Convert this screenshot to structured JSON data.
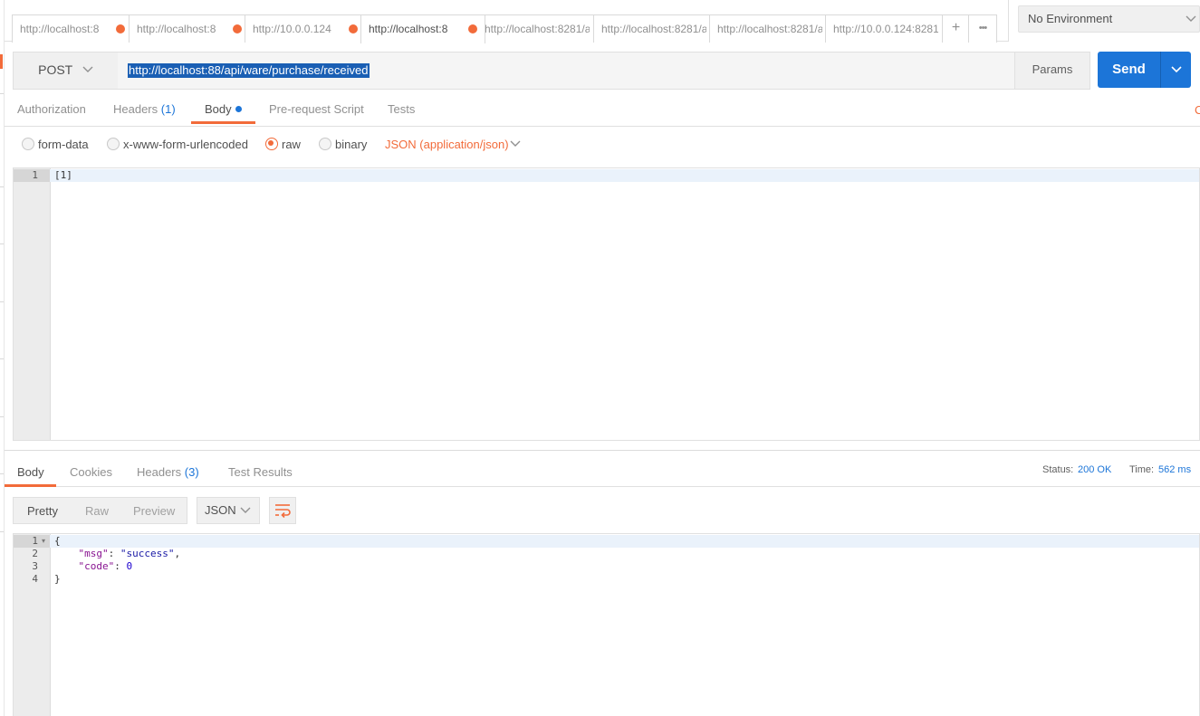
{
  "tabs": [
    {
      "label": "http://localhost:8",
      "unsaved": true
    },
    {
      "label": "http://localhost:8",
      "unsaved": true
    },
    {
      "label": "http://10.0.0.124",
      "unsaved": true
    },
    {
      "label": "http://localhost:8",
      "unsaved": true,
      "active": true
    },
    {
      "label": "http://localhost:8281/a",
      "unsaved": false
    },
    {
      "label": "http://localhost:8281/a",
      "unsaved": false
    },
    {
      "label": "http://localhost:8281/a",
      "unsaved": false
    },
    {
      "label": "http://10.0.0.124:8281/",
      "unsaved": false
    }
  ],
  "tab_actions": {
    "new_tab": "+",
    "more": "•••"
  },
  "environment": {
    "selected": "No Environment"
  },
  "request": {
    "method": "POST",
    "url": "http://localhost:88/api/ware/purchase/received",
    "params_label": "Params",
    "send_label": "Send"
  },
  "request_tabs": {
    "authorization": "Authorization",
    "headers": "Headers",
    "headers_count": "(1)",
    "body": "Body",
    "prerequest": "Pre-request Script",
    "tests": "Tests",
    "cookies_edge": "C"
  },
  "body_modes": {
    "form_data": "form-data",
    "urlencoded": "x-www-form-urlencoded",
    "raw": "raw",
    "binary": "binary",
    "selected": "raw",
    "content_type": "JSON (application/json)"
  },
  "request_body": {
    "lines": [
      "[1]"
    ]
  },
  "response_tabs": {
    "body": "Body",
    "cookies": "Cookies",
    "headers": "Headers",
    "headers_count": "(3)",
    "test_results": "Test Results"
  },
  "response_status": {
    "status_label": "Status:",
    "status_value": "200 OK",
    "time_label": "Time:",
    "time_value": "562 ms"
  },
  "response_toolbar": {
    "pretty": "Pretty",
    "raw": "Raw",
    "preview": "Preview",
    "format": "JSON"
  },
  "response_body": {
    "line1": "{",
    "line2_key": "\"msg\"",
    "line2_val": "\"success\"",
    "line3_key": "\"code\"",
    "line3_val": "0",
    "line4": "}"
  },
  "colors": {
    "accent": "#f26b3a",
    "primary": "#1c75d8"
  }
}
